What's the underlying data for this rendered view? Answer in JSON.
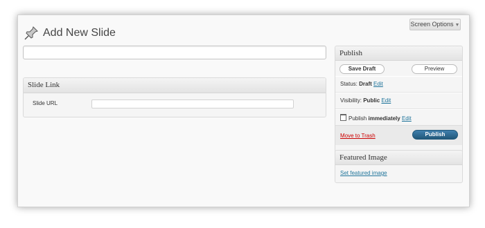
{
  "screen_options": {
    "label": "Screen Options"
  },
  "page": {
    "title": "Add New Slide"
  },
  "title_field": {
    "value": "",
    "placeholder": ""
  },
  "slide_link_box": {
    "heading": "Slide Link",
    "field_label": "Slide URL",
    "field_value": ""
  },
  "publish_box": {
    "heading": "Publish",
    "save_draft_label": "Save Draft",
    "preview_label": "Preview",
    "status_label": "Status:",
    "status_value": "Draft",
    "visibility_label": "Visibility:",
    "visibility_value": "Public",
    "edit_label": "Edit",
    "schedule_label": "Publish",
    "schedule_value": "immediately",
    "trash_label": "Move to Trash",
    "publish_label": "Publish"
  },
  "featured_image_box": {
    "heading": "Featured Image",
    "set_link": "Set featured image"
  },
  "colors": {
    "link": "#21759b",
    "trash": "#cc0000",
    "publish_button": "#21587a"
  },
  "icons": [
    "pushpin-icon",
    "chevron-down-icon",
    "calendar-icon"
  ]
}
